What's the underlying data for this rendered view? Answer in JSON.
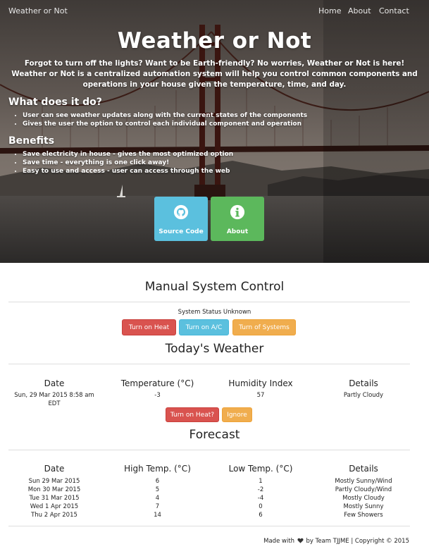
{
  "nav": {
    "brand": "Weather or Not",
    "links": [
      "Home",
      "About",
      "Contact"
    ]
  },
  "hero": {
    "title": "Weather or Not",
    "intro": "Forgot to turn off the lights? Want to be Earth-friendly? No worries, Weather or Not is here! Weather or Not is a centralized automation system will help you control common components and operations in your house given the temperature, time, and day.",
    "what_heading": "What does it do?",
    "what_items": [
      "User can see weather updates along with the current states of the components",
      "Gives the user the option to control each individual component and operation"
    ],
    "benefits_heading": "Benefits",
    "benefits_items": [
      "Save electricity in house - gives the most optimized option",
      "Save time - everything is one click away!",
      "Easy to use and access - user can access through the web"
    ],
    "tiles": [
      {
        "label": "Source Code",
        "icon": "github-icon",
        "color": "#5bc0de"
      },
      {
        "label": "About",
        "icon": "info-icon",
        "color": "#5cb85c"
      }
    ]
  },
  "manual": {
    "title": "Manual System Control",
    "status": "System Status Unknown",
    "buttons": [
      "Turn on Heat",
      "Turn on A/C",
      "Turn of Systems"
    ]
  },
  "today": {
    "title": "Today's Weather",
    "headers": [
      "Date",
      "Temperature (°C)",
      "Humidity Index",
      "Details"
    ],
    "row": {
      "date": "Sun, 29 Mar 2015 8:58 am EDT",
      "date_line1": "Sun, 29 Mar 2015 8:58 am",
      "date_line2": "EDT",
      "temperature": "-3",
      "humidity": "57",
      "details": "Partly Cloudy"
    },
    "buttons": [
      "Turn on Heat?",
      "Ignore"
    ]
  },
  "forecast": {
    "title": "Forecast",
    "headers": [
      "Date",
      "High Temp. (°C)",
      "Low Temp. (°C)",
      "Details"
    ],
    "rows": [
      {
        "date": "Sun 29 Mar 2015",
        "high": "6",
        "low": "1",
        "details": "Mostly Sunny/Wind"
      },
      {
        "date": "Mon 30 Mar 2015",
        "high": "5",
        "low": "-2",
        "details": "Partly Cloudy/Wind"
      },
      {
        "date": "Tue 31 Mar 2015",
        "high": "4",
        "low": "-4",
        "details": "Mostly Cloudy"
      },
      {
        "date": "Wed 1 Apr 2015",
        "high": "7",
        "low": "0",
        "details": "Mostly Sunny"
      },
      {
        "date": "Thu 2 Apr 2015",
        "high": "14",
        "low": "6",
        "details": "Few Showers"
      }
    ]
  },
  "footer": {
    "made_with": "Made with",
    "by_team": "by Team TJJME | Copyright © 2015",
    "icon": "heart-icon"
  }
}
